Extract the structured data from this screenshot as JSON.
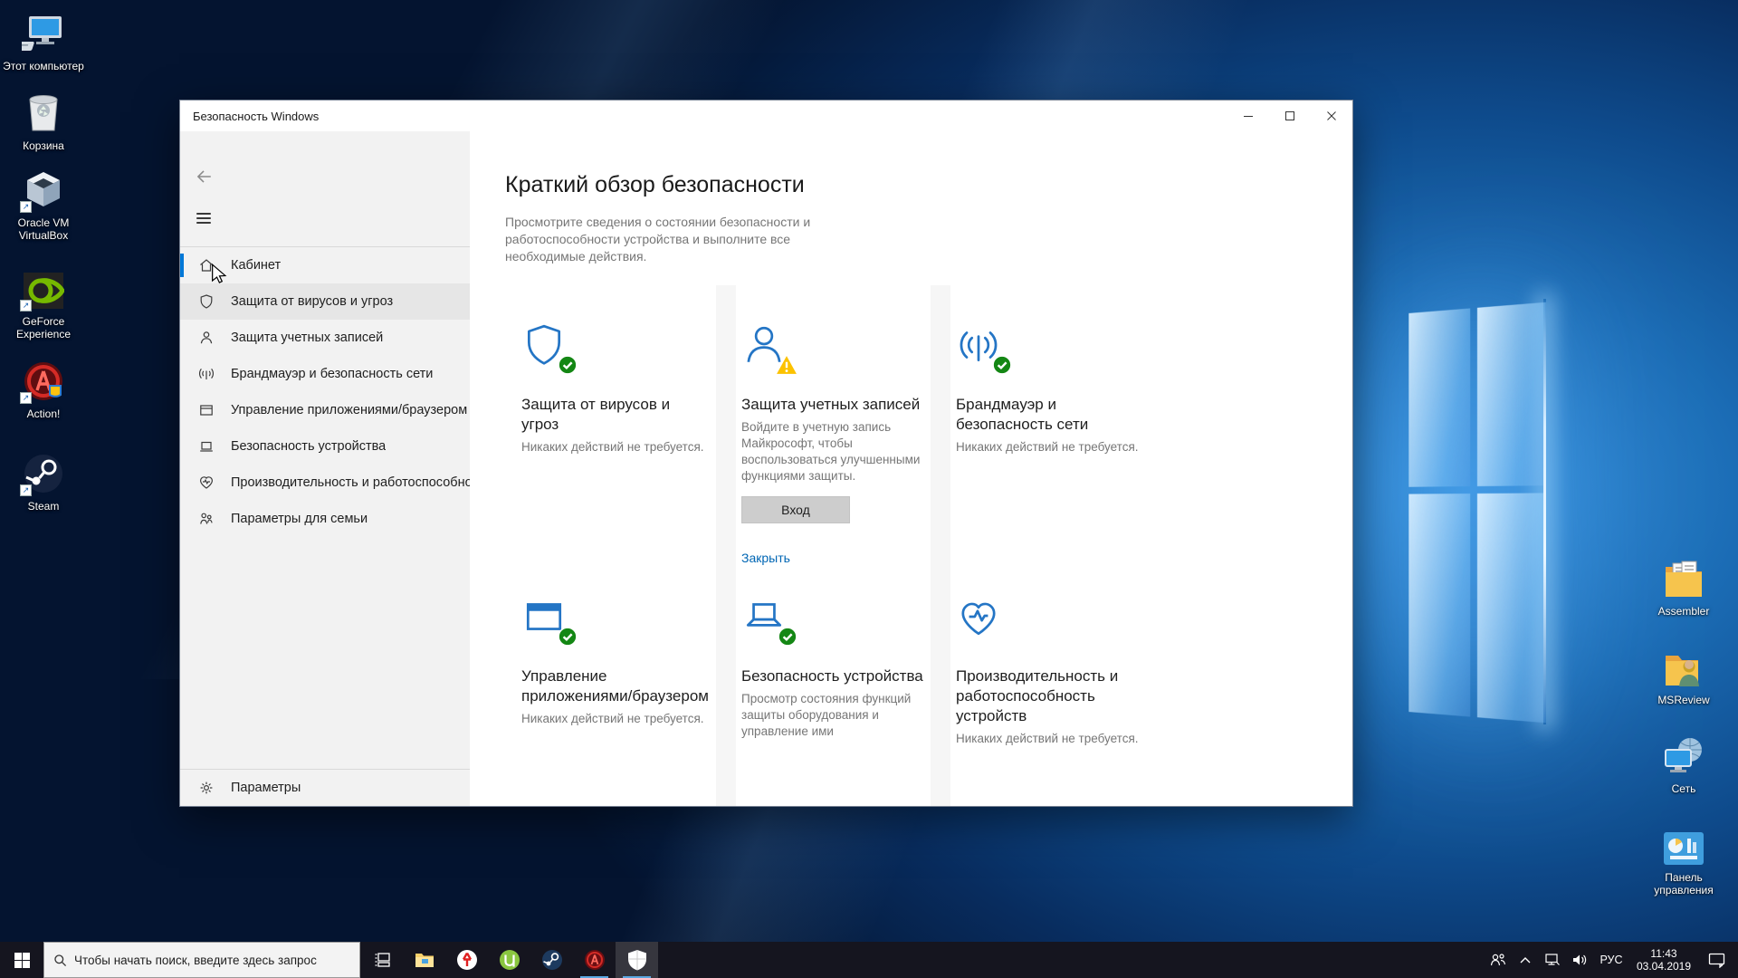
{
  "desktop": {
    "left_icons": [
      {
        "icon": "this-pc-icon",
        "label": "Этот компьютер"
      },
      {
        "icon": "recycle-bin-icon",
        "label": "Корзина"
      },
      {
        "icon": "virtualbox-icon",
        "label": "Oracle VM VirtualBox"
      },
      {
        "icon": "geforce-experience-icon",
        "label": "GeForce Experience"
      },
      {
        "icon": "action-icon",
        "label": "Action!"
      },
      {
        "icon": "steam-icon",
        "label": "Steam"
      }
    ],
    "right_icons": [
      {
        "icon": "folder-documents-icon",
        "label": "Assembler"
      },
      {
        "icon": "folder-user-icon",
        "label": "MSReview"
      },
      {
        "icon": "network-icon",
        "label": "Сеть"
      },
      {
        "icon": "control-panel-icon",
        "label": "Панель управления"
      }
    ]
  },
  "window": {
    "title": "Безопасность Windows",
    "sidebar": {
      "items": [
        {
          "label": "Кабинет",
          "icon": "home-icon",
          "state": "selected"
        },
        {
          "label": "Защита от вирусов и угроз",
          "icon": "shield-icon",
          "state": "hovered"
        },
        {
          "label": "Защита учетных записей",
          "icon": "user-icon",
          "state": "normal"
        },
        {
          "label": "Брандмауэр и безопасность сети",
          "icon": "network-signal-icon",
          "state": "normal"
        },
        {
          "label": "Управление приложениями/браузером",
          "icon": "app-window-icon",
          "state": "normal"
        },
        {
          "label": "Безопасность устройства",
          "icon": "laptop-icon",
          "state": "normal"
        },
        {
          "label": "Производительность и работоспособност",
          "icon": "device-health-icon",
          "state": "normal"
        },
        {
          "label": "Параметры для семьи",
          "icon": "family-icon",
          "state": "normal"
        }
      ],
      "settings_label": "Параметры"
    },
    "main": {
      "heading": "Краткий обзор безопасности",
      "subtitle": "Просмотрите сведения о состоянии безопасности и работоспособности устройства и выполните все необходимые действия.",
      "cards": [
        {
          "title": "Защита от вирусов и угроз",
          "status": "Никаких действий не требуется.",
          "badge": "ok"
        },
        {
          "title": "Защита учетных записей",
          "body": "Войдите в учетную запись Майкрософт, чтобы воспользоваться улучшенными функциями защиты.",
          "button_label": "Вход",
          "link_label": "Закрыть",
          "badge": "warning"
        },
        {
          "title": "Брандмауэр и безопасность сети",
          "status": "Никаких действий не требуется.",
          "badge": "ok"
        },
        {
          "title": "Управление приложениями/браузером",
          "status": "Никаких действий не требуется.",
          "badge": "ok"
        },
        {
          "title": "Безопасность устройства",
          "body": "Просмотр состояния функций защиты оборудования и управление ими",
          "badge": "ok"
        },
        {
          "title": "Производительность и работоспособность устройств",
          "status": "Никаких действий не требуется.",
          "badge": "none"
        }
      ]
    }
  },
  "taskbar": {
    "search_placeholder": "Чтобы начать поиск, введите здесь запрос",
    "language": "РУС",
    "clock": {
      "time": "11:43",
      "date": "03.04.2019"
    }
  },
  "colors": {
    "accent_blue": "#0078d7",
    "card_icon_blue": "#2475c5",
    "ok_green": "#148714",
    "warning_yellow": "#fcc200",
    "link_blue": "#0066b4",
    "taskbar_bg": "#15151f"
  }
}
